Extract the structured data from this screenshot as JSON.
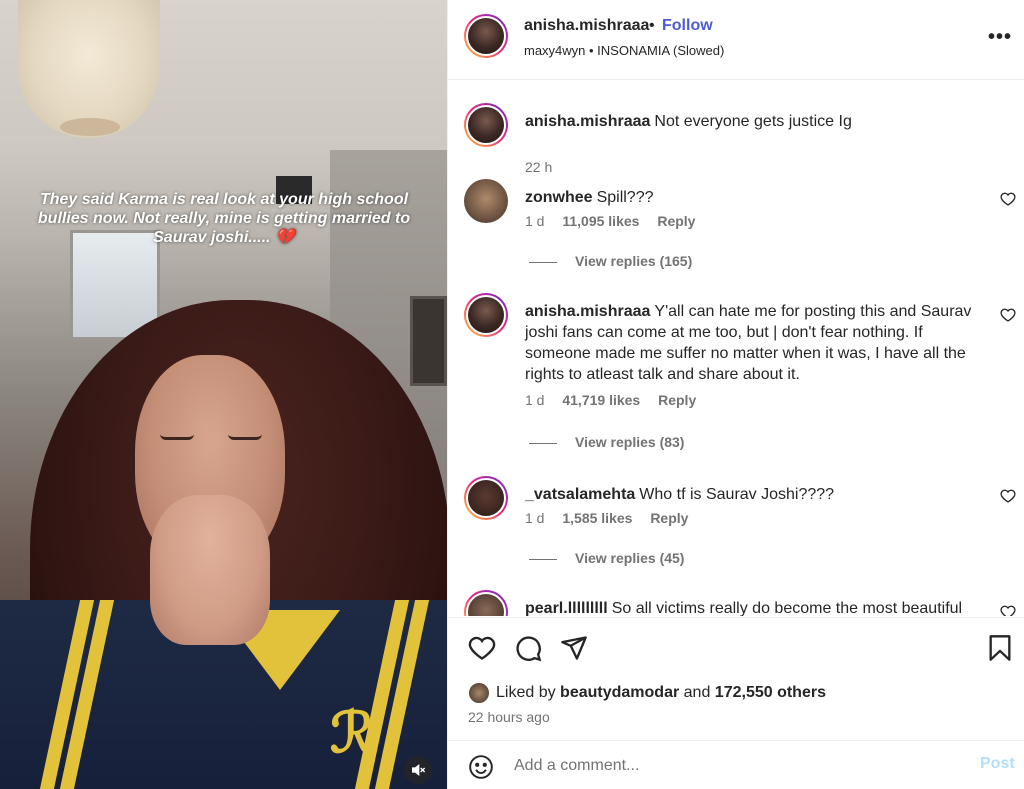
{
  "media": {
    "caption": "They said Karma is real look at your high school bullies now. Not really, mine is getting married to Saurav joshi..... 💔",
    "mute_icon": "speaker-muted-icon"
  },
  "header": {
    "username": "anisha.mishraaa",
    "separator": "•",
    "follow_label": "Follow",
    "subtitle": "maxy4wyn • INSONAMIA (Slowed)",
    "more_icon": "ellipsis-icon",
    "more_label": "•••"
  },
  "caption_comment": {
    "username": "anisha.mishraaa",
    "text": "Not everyone gets justice Ig",
    "time": "22 h"
  },
  "comments": [
    {
      "username": "zonwhee",
      "text": "Spill???",
      "time": "1 d",
      "likes": "11,095 likes",
      "reply": "Reply",
      "view_replies": "View replies (165)"
    },
    {
      "username": "anisha.mishraaa",
      "text": "Y'all can hate me for posting this and Saurav joshi fans can come at me too, but | don't fear nothing. If someone made me suffer no matter when it was, I have all the rights to atleast talk and share about it.",
      "time": "1 d",
      "likes": "41,719 likes",
      "reply": "Reply",
      "view_replies": "View replies (83)"
    },
    {
      "username": "_vatsalamehta",
      "text": "Who tf is Saurav Joshi????",
      "time": "1 d",
      "likes": "1,585 likes",
      "reply": "Reply",
      "view_replies": "View replies (45)"
    },
    {
      "username": "pearl.lllllllll",
      "text": "So all victims really do become the most beautiful"
    }
  ],
  "actions": {
    "liked_prefix": "Liked by",
    "liked_user": "beautydamodar",
    "liked_and": "and",
    "liked_others": "172,550 others",
    "time_ago": "22 hours ago"
  },
  "add_comment": {
    "placeholder": "Add a comment...",
    "post_label": "Post"
  },
  "colors": {
    "follow": "#4f5bd5",
    "post_disabled": "#b2dffc",
    "muted_text": "#737373"
  }
}
